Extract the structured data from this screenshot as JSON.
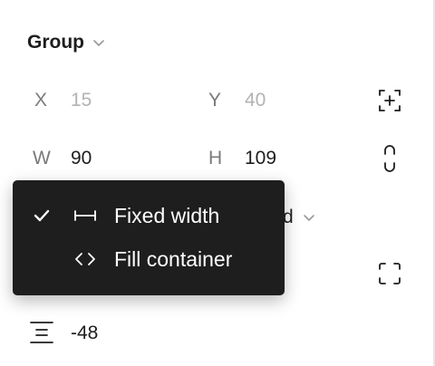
{
  "header": {
    "title": "Group"
  },
  "position": {
    "x_label": "X",
    "x_value": "15",
    "y_label": "Y",
    "y_value": "40"
  },
  "size": {
    "w_label": "W",
    "w_value": "90",
    "h_label": "H",
    "h_value": "109"
  },
  "menu": {
    "items": [
      {
        "label": "Fixed width",
        "checked": true,
        "icon": "fixed-width-icon"
      },
      {
        "label": "Fill container",
        "checked": false,
        "icon": "fill-container-icon"
      }
    ]
  },
  "behind_menu": {
    "partial_text": "d"
  },
  "spacing": {
    "value": "-48",
    "icon": "vertical-spacing-icon"
  },
  "colors": {
    "menu_bg": "#1e1e1e",
    "menu_text": "#ffffff",
    "label": "#7a7a7a",
    "muted_value": "#b3b3b3",
    "text": "#1e1e1e"
  }
}
